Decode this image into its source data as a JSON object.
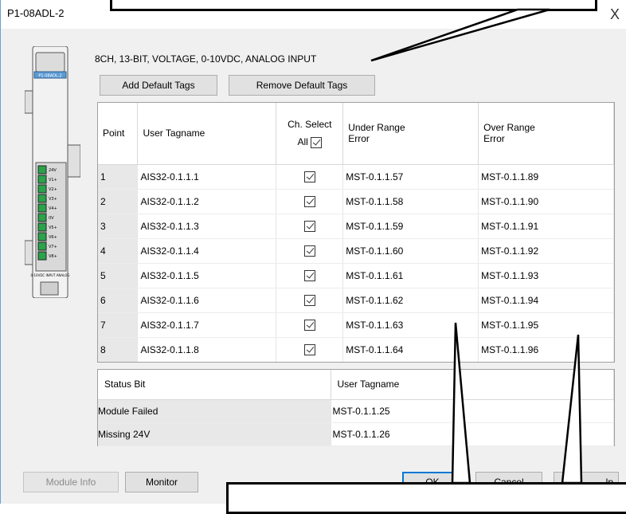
{
  "window": {
    "title": "P1-08ADL-2",
    "close_symbol": "X"
  },
  "device": {
    "model_label": "P1-08ADL-2",
    "terminal_labels": [
      "24V",
      "V1+",
      "V2+",
      "V3+",
      "V4+",
      "0V",
      "V5+",
      "V6+",
      "V7+",
      "V8+"
    ],
    "footer_label": "0-10VDC INPUT ANALOG"
  },
  "module_description": "8CH, 13-BIT, VOLTAGE, 0-10VDC, ANALOG INPUT",
  "toolbar": {
    "add_default_tags": "Add Default Tags",
    "remove_default_tags": "Remove Default Tags"
  },
  "channel_table": {
    "headers": {
      "point": "Point",
      "user_tagname": "User Tagname",
      "ch_select": "Ch. Select",
      "all": "All",
      "under_range": "Under Range\nError",
      "over_range": "Over Range\nError"
    },
    "rows": [
      {
        "point": "1",
        "tag": "AIS32-0.1.1.1",
        "selected": true,
        "under": "MST-0.1.1.57",
        "over": "MST-0.1.1.89"
      },
      {
        "point": "2",
        "tag": "AIS32-0.1.1.2",
        "selected": true,
        "under": "MST-0.1.1.58",
        "over": "MST-0.1.1.90"
      },
      {
        "point": "3",
        "tag": "AIS32-0.1.1.3",
        "selected": true,
        "under": "MST-0.1.1.59",
        "over": "MST-0.1.1.91"
      },
      {
        "point": "4",
        "tag": "AIS32-0.1.1.4",
        "selected": true,
        "under": "MST-0.1.1.60",
        "over": "MST-0.1.1.92"
      },
      {
        "point": "5",
        "tag": "AIS32-0.1.1.5",
        "selected": true,
        "under": "MST-0.1.1.61",
        "over": "MST-0.1.1.93"
      },
      {
        "point": "6",
        "tag": "AIS32-0.1.1.6",
        "selected": true,
        "under": "MST-0.1.1.62",
        "over": "MST-0.1.1.94"
      },
      {
        "point": "7",
        "tag": "AIS32-0.1.1.7",
        "selected": true,
        "under": "MST-0.1.1.63",
        "over": "MST-0.1.1.95"
      },
      {
        "point": "8",
        "tag": "AIS32-0.1.1.8",
        "selected": true,
        "under": "MST-0.1.1.64",
        "over": "MST-0.1.1.96"
      }
    ]
  },
  "status_table": {
    "headers": {
      "status_bit": "Status Bit",
      "user_tagname": "User Tagname"
    },
    "rows": [
      {
        "label": "Module Failed",
        "tag": "MST-0.1.1.25"
      },
      {
        "label": "Missing 24V",
        "tag": "MST-0.1.1.26"
      }
    ]
  },
  "footer_buttons": {
    "module_info": "Module Info",
    "monitor": "Monitor",
    "ok": "OK",
    "cancel": "Cancel",
    "help": "lp"
  }
}
